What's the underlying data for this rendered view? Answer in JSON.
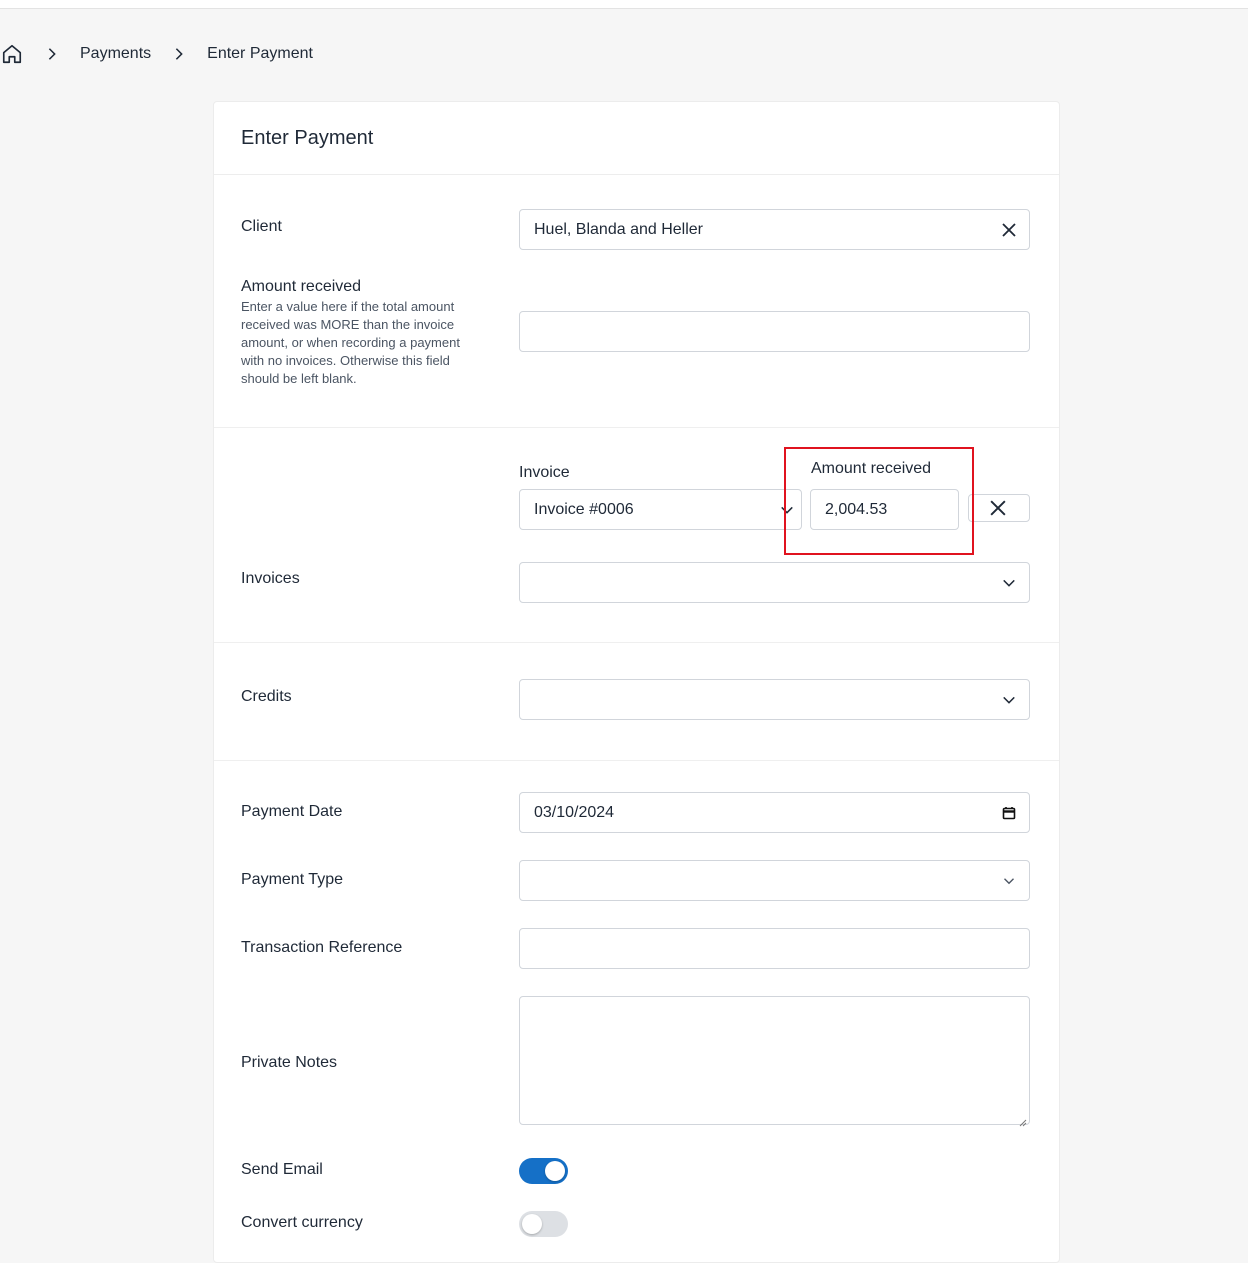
{
  "breadcrumb": {
    "items": [
      "Payments",
      "Enter Payment"
    ]
  },
  "card": {
    "title": "Enter Payment"
  },
  "client": {
    "label": "Client",
    "value": "Huel, Blanda and Heller"
  },
  "amount_received": {
    "label": "Amount received",
    "help": "Enter a value here if the total amount received was MORE than the invoice amount, or when recording a payment with no invoices. Otherwise this field should be left blank.",
    "value": ""
  },
  "invoice_row": {
    "invoice_label": "Invoice",
    "invoice_value": "Invoice #0006",
    "amount_label": "Amount received",
    "amount_value": "2,004.53"
  },
  "invoices": {
    "label": "Invoices",
    "value": ""
  },
  "credits": {
    "label": "Credits",
    "value": ""
  },
  "payment_date": {
    "label": "Payment Date",
    "value": "03/10/2024"
  },
  "payment_type": {
    "label": "Payment Type",
    "value": ""
  },
  "transaction_reference": {
    "label": "Transaction Reference",
    "value": ""
  },
  "private_notes": {
    "label": "Private Notes",
    "value": ""
  },
  "send_email": {
    "label": "Send Email",
    "checked": true
  },
  "convert_currency": {
    "label": "Convert currency",
    "checked": false
  },
  "colors": {
    "accent": "#1570c7",
    "highlight": "#e0131f"
  },
  "icons": [
    "home-icon",
    "chevron-right-icon",
    "close-icon",
    "chevron-down-icon",
    "calendar-icon"
  ]
}
